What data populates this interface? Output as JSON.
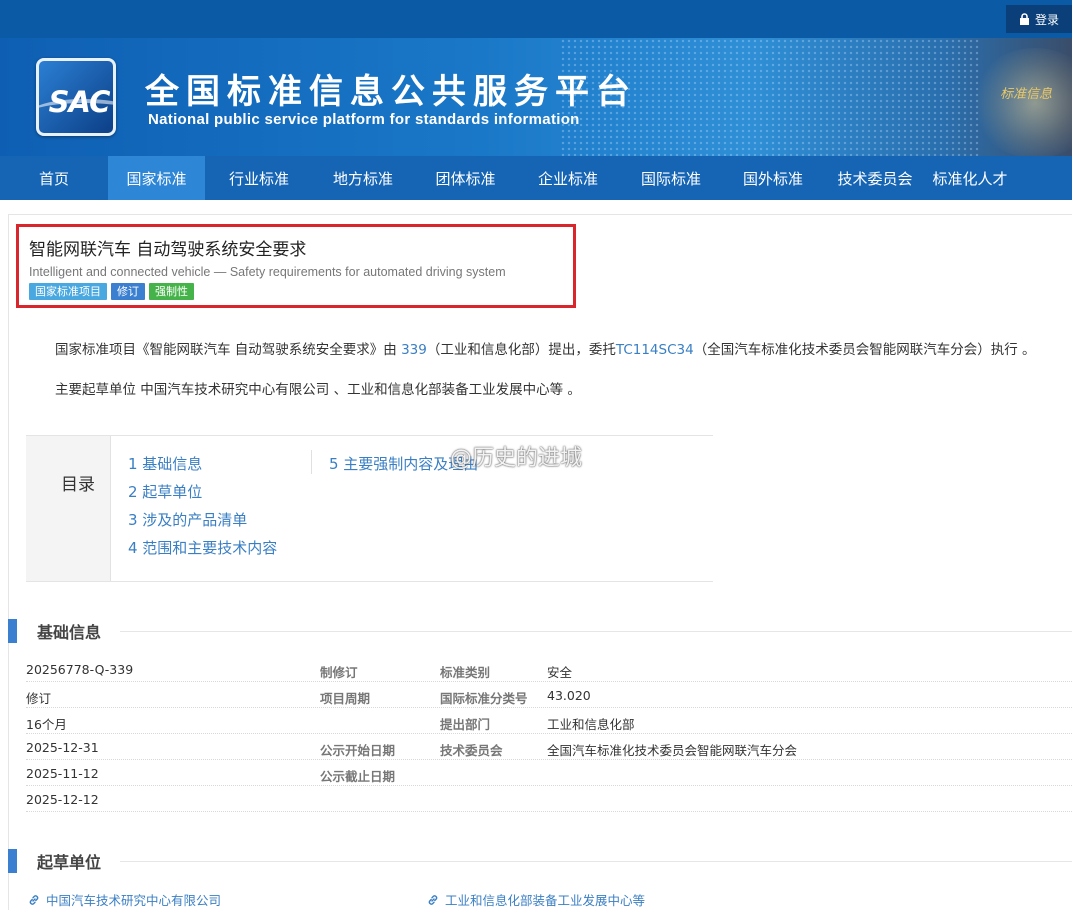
{
  "header": {
    "login_label": "登录",
    "logo_text": "SAC",
    "site_title_cn": "全国标准信息公共服务平台",
    "site_title_en": "National public service platform  for standards information",
    "seal_text": "标准信息"
  },
  "nav": {
    "items": [
      "首页",
      "国家标准",
      "行业标准",
      "地方标准",
      "团体标准",
      "企业标准",
      "国际标准",
      "国外标准",
      "技术委员会",
      "标准化人才"
    ],
    "active_index": 1
  },
  "standard": {
    "title_cn": "智能网联汽车 自动驾驶系统安全要求",
    "title_en": "Intelligent and connected vehicle — Safety requirements for automated driving system",
    "tags": [
      "国家标准项目",
      "修订",
      "强制性"
    ]
  },
  "description": {
    "line1_prefix": "国家标准项目《智能网联汽车 自动驾驶系统安全要求》由 ",
    "line1_link1": "339",
    "line1_middle": "（工业和信息化部）提出，委托",
    "line1_link2": "TC114SC34",
    "line1_suffix": "（全国汽车标准化技术委员会智能网联汽车分会）执行 。",
    "line2": "主要起草单位 中国汽车技术研究中心有限公司 、工业和信息化部装备工业发展中心等 。"
  },
  "toc": {
    "label": "目录",
    "items": [
      "1  基础信息",
      "2  起草单位",
      "3  涉及的产品清单",
      "4  范围和主要技术内容",
      "5  主要强制内容及理由"
    ]
  },
  "watermark": {
    "text": "@历史的进城"
  },
  "basic_info": {
    "heading": "基础信息",
    "rows": [
      {
        "c1": "20256778-Q-339",
        "l2": "制修订",
        "l3": "标准类别",
        "v3": "安全"
      },
      {
        "c1": "修订",
        "l2": "项目周期",
        "l3": "国际标准分类号",
        "v3": "43.020"
      },
      {
        "c1": "16个月",
        "l2": "",
        "l3": "提出部门",
        "v3": "工业和信息化部"
      },
      {
        "c1": "2025-12-31",
        "l2": "公示开始日期",
        "l3": "技术委员会",
        "v3": "全国汽车标准化技术委员会智能网联汽车分会"
      },
      {
        "c1": "2025-11-12",
        "l2": "公示截止日期",
        "l3": "",
        "v3": ""
      },
      {
        "c1": "2025-12-12",
        "l2": "",
        "l3": "",
        "v3": ""
      }
    ]
  },
  "drafting": {
    "heading": "起草单位",
    "units": [
      "中国汽车技术研究中心有限公司",
      "工业和信息化部装备工业发展中心等"
    ]
  }
}
